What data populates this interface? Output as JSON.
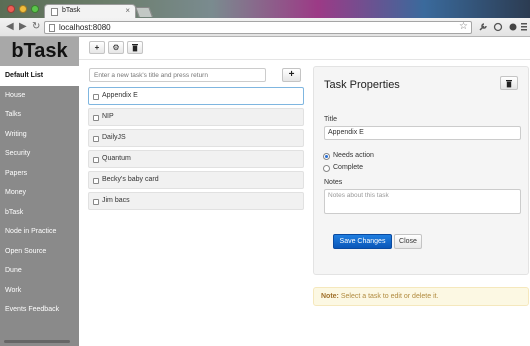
{
  "browser": {
    "tab_title": "bTask",
    "tab_close": "×",
    "url": "localhost:8080",
    "back_glyph": "◀",
    "forward_glyph": "▶",
    "reload_glyph": "↻",
    "star_glyph": "☆"
  },
  "sidebar": {
    "brand": "bTask",
    "items": [
      {
        "label": "Default List",
        "active": true
      },
      {
        "label": "House"
      },
      {
        "label": "Talks"
      },
      {
        "label": "Writing"
      },
      {
        "label": "Security"
      },
      {
        "label": "Papers"
      },
      {
        "label": "Money"
      },
      {
        "label": "bTask"
      },
      {
        "label": "Node in Practice"
      },
      {
        "label": "Open Source"
      },
      {
        "label": "Dune"
      },
      {
        "label": "Work"
      },
      {
        "label": "Events Feedback"
      }
    ]
  },
  "app_toolbar": {
    "add_glyph": "+",
    "settings_glyph": "⚙",
    "delete_glyph": "🗑"
  },
  "tasks": {
    "input_placeholder": "Enter a new task's title and press return",
    "add_glyph": "+",
    "items": [
      {
        "label": "Appendix E",
        "selected": true
      },
      {
        "label": "NIP"
      },
      {
        "label": "DailyJS"
      },
      {
        "label": "Quantum"
      },
      {
        "label": "Becky's baby card"
      },
      {
        "label": "Jim bacs"
      }
    ]
  },
  "properties": {
    "heading": "Task Properties",
    "delete_glyph": "🗑",
    "title_label": "Title",
    "title_value": "Appendix E",
    "status_options": [
      {
        "label": "Needs action",
        "checked": true
      },
      {
        "label": "Complete",
        "checked": false
      }
    ],
    "notes_label": "Notes",
    "notes_placeholder": "Notes about this task",
    "save_label": "Save Changes",
    "close_label": "Close"
  },
  "note": {
    "prefix": "Note:",
    "text": "Select a task to edit or delete it."
  },
  "colors": {
    "primary": "#0a62c9",
    "sidebar": "#8a8a8a",
    "note_bg": "#fcf8e3"
  }
}
